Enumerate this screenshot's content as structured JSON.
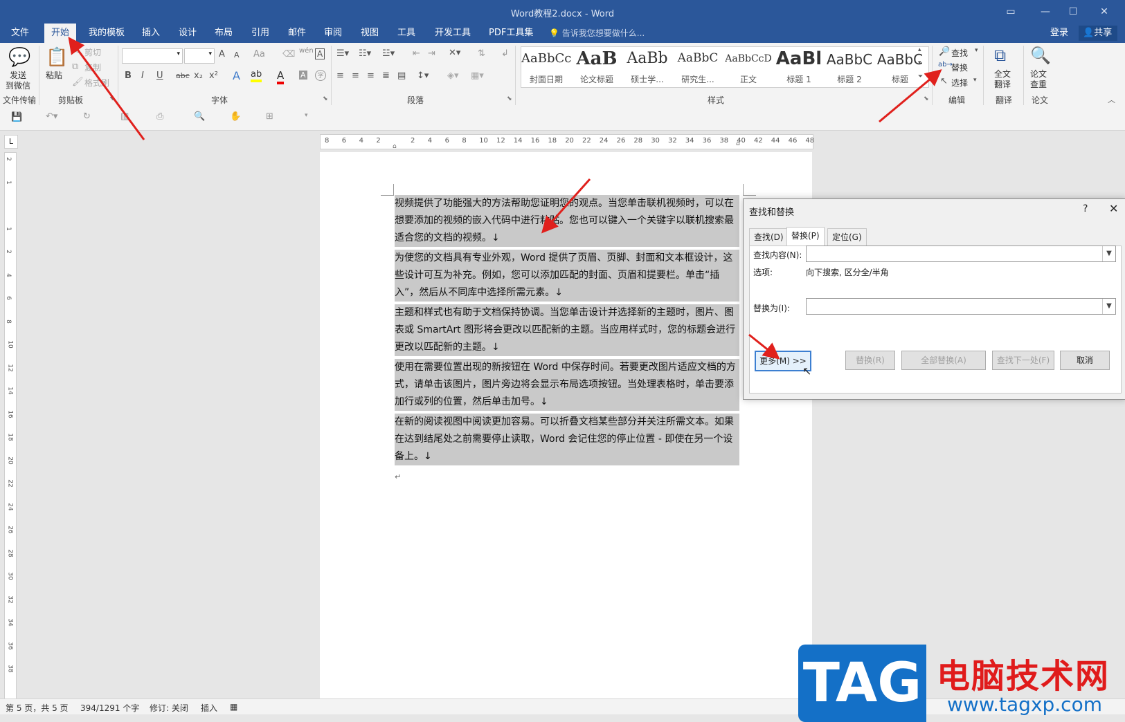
{
  "window": {
    "title": "Word教程2.docx - Word"
  },
  "tabs": [
    "文件",
    "开始",
    "我的模板",
    "插入",
    "设计",
    "布局",
    "引用",
    "邮件",
    "审阅",
    "视图",
    "工具",
    "开发工具",
    "PDF工具集"
  ],
  "active_tab": "开始",
  "tell_me": "告诉我您想要做什么...",
  "account": {
    "login": "登录",
    "share": "共享"
  },
  "ribbon": {
    "wechat": {
      "line1": "发送",
      "line2": "到微信",
      "group": "文件传输"
    },
    "clipboard": {
      "paste": "粘贴",
      "cut": "剪切",
      "copy": "复制",
      "format_painter": "格式刷",
      "group": "剪贴板"
    },
    "font": {
      "group": "字体",
      "bold": "B",
      "italic": "I",
      "underline": "U",
      "strike": "abc",
      "sub": "x₂",
      "sup": "x²",
      "wen": "wén",
      "a_big": "A",
      "a_small": "A",
      "aa": "Aa"
    },
    "paragraph": {
      "group": "段落"
    },
    "styles": {
      "group": "样式",
      "items": [
        {
          "sample": "AaBbCc",
          "name": "封面日期"
        },
        {
          "sample": "AaB",
          "name": "论文标题"
        },
        {
          "sample": "AaBb",
          "name": "硕士学..."
        },
        {
          "sample": "AaBbC",
          "name": "研究生..."
        },
        {
          "sample": "AaBbCcD",
          "name": "正文"
        },
        {
          "sample": "AaBl",
          "name": "标题 1"
        },
        {
          "sample": "AaBbC",
          "name": "标题 2"
        },
        {
          "sample": "AaBbC",
          "name": "标题"
        }
      ]
    },
    "editing": {
      "find": "查找",
      "replace": "替换",
      "select": "选择",
      "group": "编辑"
    },
    "translate": {
      "line1": "全文",
      "line2": "翻译",
      "group": "翻译"
    },
    "paper": {
      "line1": "论文",
      "line2": "查重",
      "group": "论文"
    }
  },
  "ruler": {
    "h": [
      "8",
      "6",
      "4",
      "2",
      "",
      "2",
      "4",
      "6",
      "8",
      "10",
      "12",
      "14",
      "16",
      "18",
      "20",
      "22",
      "24",
      "26",
      "28",
      "30",
      "32",
      "34",
      "36",
      "38",
      "40",
      "42",
      "44",
      "46",
      "48"
    ],
    "v": [
      "2",
      "1",
      "",
      "1",
      "2",
      "4",
      "6",
      "8",
      "10",
      "12",
      "14",
      "16",
      "18",
      "20",
      "22",
      "24",
      "26",
      "28",
      "30",
      "32",
      "34",
      "36",
      "38"
    ]
  },
  "document": {
    "paragraphs": [
      "    视频提供了功能强大的方法帮助您证明您的观点。当您单击联机视频时，可以在想要添加的视频的嵌入代码中进行粘贴。您也可以键入一个关键字以联机搜索最适合您的文档的视频。↓",
      "为使您的文档具有专业外观，Word 提供了页眉、页脚、封面和文本框设计，这些设计可互为补充。例如，您可以添加匹配的封面、页眉和提要栏。单击“插入”，然后从不同库中选择所需元素。↓",
      "主题和样式也有助于文档保持协调。当您单击设计并选择新的主题时，图片、图表或 SmartArt 图形将会更改以匹配新的主题。当应用样式时，您的标题会进行更改以匹配新的主题。↓",
      "使用在需要位置出现的新按钮在 Word 中保存时间。若要更改图片适应文档的方式，请单击该图片，图片旁边将会显示布局选项按钮。当处理表格时，单击要添加行或列的位置，然后单击加号。↓",
      "在新的阅读视图中阅读更加容易。可以折叠文档某些部分并关注所需文本。如果在达到结尾处之前需要停止读取，Word 会记住您的停止位置 - 即使在另一个设备上。↓"
    ],
    "end_mark": "↵"
  },
  "dialog": {
    "title": "查找和替换",
    "help": "?",
    "close": "✕",
    "tabs": [
      "查找(D)",
      "替换(P)",
      "定位(G)"
    ],
    "active_tab": "替换(P)",
    "find_label": "查找内容(N):",
    "find_value": "",
    "options_label": "选项:",
    "options_value": "向下搜索, 区分全/半角",
    "replace_label": "替换为(I):",
    "replace_value": "",
    "buttons": {
      "more": "更多(M) >>",
      "replace": "替换(R)",
      "replace_all": "全部替换(A)",
      "find_next": "查找下一处(F)",
      "cancel": "取消"
    }
  },
  "status": {
    "page": "第 5 页，共 5 页",
    "words": "394/1291 个字",
    "track": "修订: 关闭",
    "mode": "插入"
  },
  "watermark": {
    "tag": "TAG",
    "name": "电脑技术网",
    "url": "www.tagxp.com"
  },
  "colors": {
    "brand": "#2b579a",
    "arrow": "#e0201c",
    "selection": "#c9c9c9"
  }
}
